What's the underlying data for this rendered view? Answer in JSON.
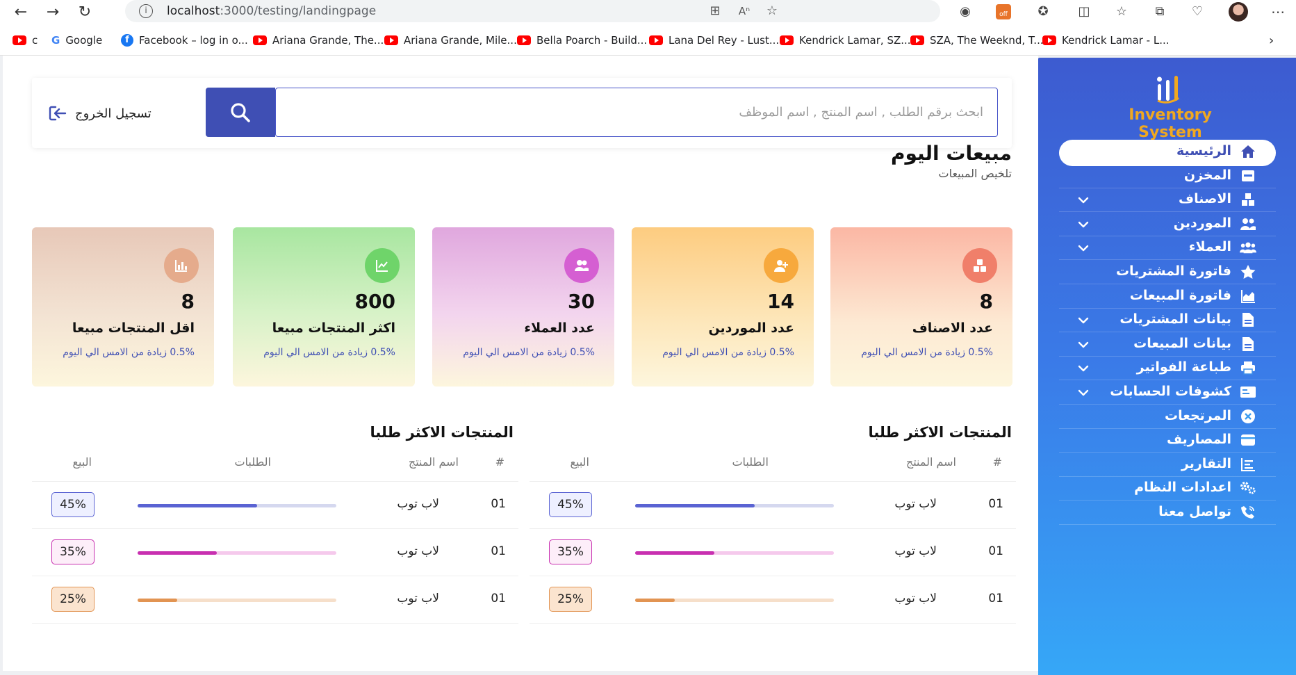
{
  "browser": {
    "url_host": "localhost",
    "url_path": ":3000/testing/landingpage",
    "bookmarks": [
      {
        "icon": "youtube-icon",
        "label": "c"
      },
      {
        "icon": "google-icon",
        "label": "Google"
      },
      {
        "icon": "facebook-icon",
        "label": "Facebook – log in o..."
      },
      {
        "icon": "youtube-icon",
        "label": "Ariana Grande, The..."
      },
      {
        "icon": "youtube-icon",
        "label": "Ariana Grande, Mile..."
      },
      {
        "icon": "youtube-icon",
        "label": "Bella Poarch - Build..."
      },
      {
        "icon": "youtube-icon",
        "label": "Lana Del Rey - Lust..."
      },
      {
        "icon": "youtube-icon",
        "label": "Kendrick Lamar, SZ..."
      },
      {
        "icon": "youtube-icon",
        "label": "SZA, The Weeknd, T..."
      },
      {
        "icon": "youtube-icon",
        "label": "Kendrick Lamar - L..."
      }
    ],
    "ext_badge": "off"
  },
  "header": {
    "search_placeholder": "ابحث برقم الطلب , اسم المنتج , اسم الموظف",
    "logout_label": "تسجيل الخروج"
  },
  "today": {
    "title": "مبيعات اليوم",
    "subtitle": "تلخيص المبيعات"
  },
  "stats": [
    {
      "value": "8",
      "label": "عدد الاصناف",
      "note": "0.5% زيادة من الامس الي اليوم",
      "icon": "boxes-icon",
      "color": "#f07f6a"
    },
    {
      "value": "14",
      "label": "عدد الموردين",
      "note": "0.5% زيادة من الامس الي اليوم",
      "icon": "user-plus-icon",
      "color": "#f7a93d"
    },
    {
      "value": "30",
      "label": "عدد العملاء",
      "note": "0.5% زيادة من الامس الي اليوم",
      "icon": "users-icon",
      "color": "#d55fd2"
    },
    {
      "value": "800",
      "label": "اكثر المنتجات مبيعا",
      "note": "0.5% زيادة من الامس الي اليوم",
      "icon": "chart-line-icon",
      "color": "#6fd46a"
    },
    {
      "value": "8",
      "label": "اقل المنتجات مبيعا",
      "note": "0.5% زيادة من الامس الي اليوم",
      "icon": "chart-bar-icon",
      "color": "#e5ab8c"
    }
  ],
  "tables": [
    {
      "title": "المنتجات الاكثر طلبا",
      "headers": {
        "num": "#",
        "name": "اسم المنتج",
        "orders": "الطلبات",
        "sale": "البيع"
      },
      "rows": [
        {
          "num": "01",
          "name": "لاب توب",
          "percent": 60,
          "sale": "45%",
          "color": "#5a63d3",
          "track": "#d5d8ef",
          "badge_bg": "#eef0ff",
          "badge_border": "#5a63d3"
        },
        {
          "num": "01",
          "name": "لاب توب",
          "percent": 40,
          "sale": "35%",
          "color": "#c82fb0",
          "track": "#f5c9ec",
          "badge_bg": "#fdeef9",
          "badge_border": "#c82fb0"
        },
        {
          "num": "01",
          "name": "لاب توب",
          "percent": 20,
          "sale": "25%",
          "color": "#e29452",
          "track": "#f6dfca",
          "badge_bg": "#fbe4cf",
          "badge_border": "#e29452"
        }
      ]
    },
    {
      "title": "المنتجات الاكثر طلبا",
      "headers": {
        "num": "#",
        "name": "اسم المنتج",
        "orders": "الطلبات",
        "sale": "البيع"
      },
      "rows": [
        {
          "num": "01",
          "name": "لاب توب",
          "percent": 60,
          "sale": "45%",
          "color": "#5a63d3",
          "track": "#d5d8ef",
          "badge_bg": "#eef0ff",
          "badge_border": "#5a63d3"
        },
        {
          "num": "01",
          "name": "لاب توب",
          "percent": 40,
          "sale": "35%",
          "color": "#c82fb0",
          "track": "#f5c9ec",
          "badge_bg": "#fdeef9",
          "badge_border": "#c82fb0"
        },
        {
          "num": "01",
          "name": "لاب توب",
          "percent": 20,
          "sale": "25%",
          "color": "#e29452",
          "track": "#f6dfca",
          "badge_bg": "#fbe4cf",
          "badge_border": "#e29452"
        }
      ]
    }
  ],
  "sidebar": {
    "logo_text": "Inventory System",
    "items": [
      {
        "label": "الرئيسية",
        "icon": "home-icon",
        "active": true,
        "chevron": false
      },
      {
        "label": "المخزن",
        "icon": "warehouse-icon",
        "active": false,
        "chevron": false
      },
      {
        "label": "الاصناف",
        "icon": "boxes-icon",
        "active": false,
        "chevron": true
      },
      {
        "label": "الموردين",
        "icon": "users-icon",
        "active": false,
        "chevron": true
      },
      {
        "label": "العملاء",
        "icon": "user-group-icon",
        "active": false,
        "chevron": true
      },
      {
        "label": "فاتورة المشتريات",
        "icon": "star-icon",
        "active": false,
        "chevron": false
      },
      {
        "label": "فاتورة المبيعات",
        "icon": "chart-area-icon",
        "active": false,
        "chevron": false
      },
      {
        "label": "بيانات المشتريات",
        "icon": "file-icon",
        "active": false,
        "chevron": true
      },
      {
        "label": "بيانات المبيعات",
        "icon": "file-icon",
        "active": false,
        "chevron": true
      },
      {
        "label": "طباعة الفواتير",
        "icon": "print-icon",
        "active": false,
        "chevron": true
      },
      {
        "label": "كشوفات الحسابات",
        "icon": "id-card-icon",
        "active": false,
        "chevron": true
      },
      {
        "label": "المرتجعات",
        "icon": "circle-x-icon",
        "active": false,
        "chevron": false
      },
      {
        "label": "المصاريف",
        "icon": "wallet-icon",
        "active": false,
        "chevron": false
      },
      {
        "label": "التقارير",
        "icon": "chart-list-icon",
        "active": false,
        "chevron": false
      },
      {
        "label": "اعدادات النظام",
        "icon": "gears-icon",
        "active": false,
        "chevron": false
      },
      {
        "label": "تواصل معنا",
        "icon": "phone-icon",
        "active": false,
        "chevron": false
      }
    ]
  }
}
